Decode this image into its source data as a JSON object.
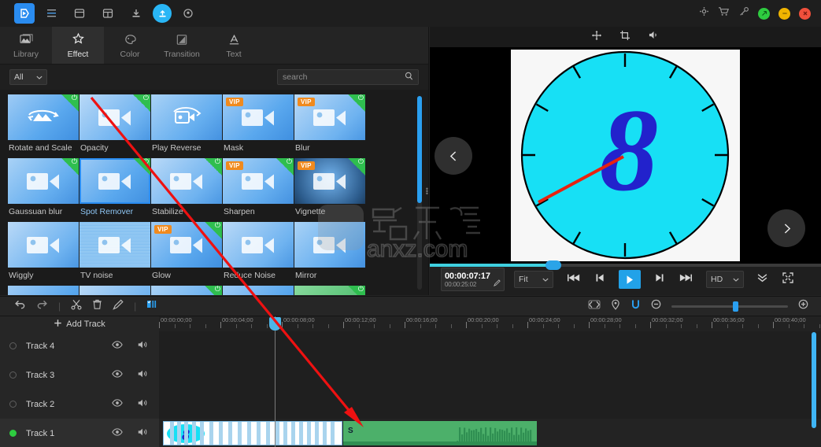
{
  "titlebar": {
    "icons": [
      "app-logo",
      "menu-icon",
      "new-project-icon",
      "open-project-icon",
      "import-icon",
      "export-icon",
      "record-icon"
    ],
    "right_icons": [
      "settings-gear-icon",
      "shopping-cart-icon",
      "key-icon"
    ],
    "window_buttons": [
      "maximize",
      "minimize",
      "close"
    ]
  },
  "tabs": [
    {
      "label": "Library",
      "icon": "library-icon"
    },
    {
      "label": "Effect",
      "icon": "effect-star-icon"
    },
    {
      "label": "Color",
      "icon": "color-palette-icon"
    },
    {
      "label": "Transition",
      "icon": "transition-icon"
    },
    {
      "label": "Text",
      "icon": "text-a-icon"
    }
  ],
  "filter": {
    "selected": "All",
    "options": [
      "All"
    ]
  },
  "search": {
    "placeholder": "search",
    "value": ""
  },
  "effects": [
    {
      "label": "Rotate and Scale",
      "vip": false,
      "power": true,
      "glyph": "rotate",
      "selected": false
    },
    {
      "label": "Opacity",
      "vip": false,
      "power": true,
      "glyph": "cam",
      "selected": false
    },
    {
      "label": "Play Reverse",
      "vip": false,
      "power": false,
      "glyph": "reverse",
      "selected": false
    },
    {
      "label": "Mask",
      "vip": true,
      "power": false,
      "glyph": "cam",
      "selected": false
    },
    {
      "label": "Blur",
      "vip": true,
      "power": true,
      "glyph": "cam",
      "selected": false
    },
    {
      "label": "Gaussuan blur",
      "vip": false,
      "power": true,
      "glyph": "cam",
      "selected": false
    },
    {
      "label": "Spot Remover",
      "vip": false,
      "power": true,
      "glyph": "cam",
      "selected": true
    },
    {
      "label": "Stabilize",
      "vip": false,
      "power": true,
      "glyph": "cam",
      "selected": false
    },
    {
      "label": "Sharpen",
      "vip": true,
      "power": true,
      "glyph": "cam",
      "selected": false
    },
    {
      "label": "Vignette",
      "vip": true,
      "power": true,
      "glyph": "cam",
      "selected": false
    },
    {
      "label": "Wiggly",
      "vip": false,
      "power": false,
      "glyph": "cam",
      "selected": false
    },
    {
      "label": "TV noise",
      "vip": false,
      "power": false,
      "glyph": "cam",
      "selected": false
    },
    {
      "label": "Glow",
      "vip": true,
      "power": true,
      "glyph": "cam",
      "selected": false
    },
    {
      "label": "Reduce Noise",
      "vip": false,
      "power": false,
      "glyph": "cam",
      "selected": false
    },
    {
      "label": "Mirror",
      "vip": false,
      "power": false,
      "glyph": "cam",
      "selected": false
    },
    {
      "label": "",
      "vip": false,
      "power": false,
      "glyph": "cam",
      "selected": false
    },
    {
      "label": "",
      "vip": false,
      "power": false,
      "glyph": "cam",
      "selected": false
    },
    {
      "label": "",
      "vip": false,
      "power": true,
      "glyph": "cam",
      "selected": false
    },
    {
      "label": "",
      "vip": false,
      "power": false,
      "glyph": "cam",
      "selected": false
    },
    {
      "label": "",
      "vip": false,
      "power": true,
      "glyph": "music",
      "selected": false
    }
  ],
  "preview": {
    "overlay_icons": [
      "move-icon",
      "crop-icon",
      "volume-icon"
    ],
    "nav_prev": "chevron-left-icon",
    "nav_next": "chevron-right-icon",
    "current_time": "00:00:07:17",
    "total_time": "00:00:25:02",
    "fit_mode": "Fit",
    "quality": "HD",
    "transport": [
      "skip-start-icon",
      "prev-frame-icon",
      "play-icon",
      "next-frame-icon",
      "skip-end-icon"
    ],
    "end_icons": [
      "collapse-chevrons-icon",
      "fullscreen-icon"
    ],
    "progress_percent": 31
  },
  "timeline_toolbar": {
    "left_icons": [
      "undo-icon",
      "redo-icon",
      "cut-scissors-icon",
      "delete-trash-icon",
      "edit-pencil-icon",
      "marker-icon"
    ],
    "right_icons": [
      "keyframe-icon",
      "marker-pin-icon",
      "snap-magnet-icon",
      "zoom-out-icon",
      "zoom-in-icon"
    ],
    "zoom_value": 53
  },
  "timeline": {
    "add_track_label": "Add Track",
    "ruler_labels": [
      "00:00:00;00",
      "00:00:04;00",
      "00:00:08;00",
      "00:00:12;00",
      "00:00:16;00",
      "00:00:20;00",
      "00:00:24;00",
      "00:00:28;00",
      "00:00:32;00",
      "00:00:36;00",
      "00:00:40;00"
    ],
    "tracks": [
      {
        "name": "Track 4",
        "active": false,
        "eye": "eye-icon",
        "speaker": "speaker-icon"
      },
      {
        "name": "Track 3",
        "active": false,
        "eye": "eye-icon",
        "speaker": "speaker-icon"
      },
      {
        "name": "Track 2",
        "active": false,
        "eye": "eye-icon",
        "speaker": "speaker-icon"
      },
      {
        "name": "Track 1",
        "active": true,
        "eye": "eye-icon",
        "speaker": "speaker-icon"
      }
    ],
    "audio_clip_label": "S",
    "playhead_time": "00:00:07:17"
  },
  "watermark": {
    "text": "anxz.com"
  },
  "colors": {
    "accent_blue": "#2a8cf0",
    "player_blue": "#22a2e8",
    "seek_cyan": "#3fd0e0",
    "vip_orange": "#f08a1e",
    "power_green": "#2fbe4f",
    "audio_green": "#4cb06a",
    "panel_bg": "#242424",
    "grid_bg": "#1b1b1b",
    "timeline_bg": "#1e1e1e"
  }
}
